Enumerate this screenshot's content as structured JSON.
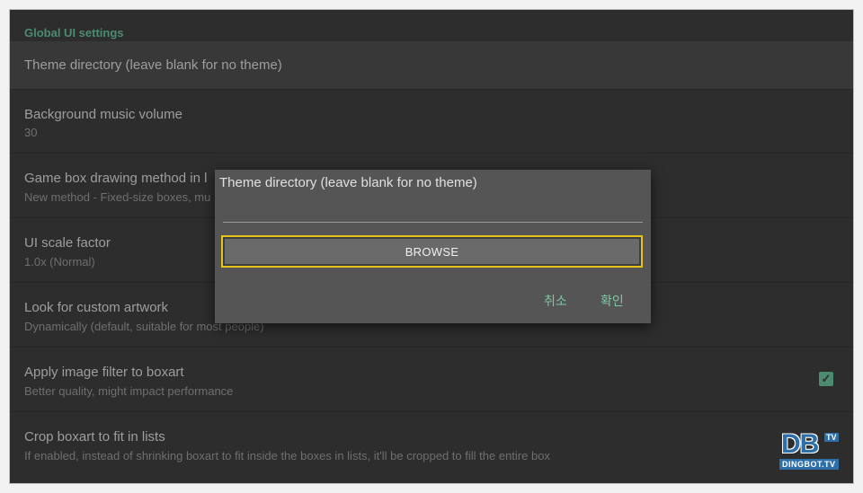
{
  "section": {
    "title": "Global UI settings"
  },
  "prefs": [
    {
      "title": "Theme directory (leave blank for no theme)",
      "summary": ""
    },
    {
      "title": "Background music volume",
      "summary": "30"
    },
    {
      "title": "Game box drawing method in l",
      "summary": "New method - Fixed-size boxes, mu"
    },
    {
      "title": "UI scale factor",
      "summary": "1.0x (Normal)"
    },
    {
      "title": "Look for custom artwork",
      "summary": "Dynamically (default, suitable for most people)"
    },
    {
      "title": "Apply image filter to boxart",
      "summary": "Better quality, might impact performance",
      "checked": true
    },
    {
      "title": "Crop boxart to fit in lists",
      "summary": "If enabled, instead of shrinking boxart to fit inside the boxes in lists, it'll be cropped to fill the entire box"
    }
  ],
  "dialog": {
    "title": "Theme directory (leave blank for no theme)",
    "input_value": "",
    "browse_label": "BROWSE",
    "cancel_label": "취소",
    "ok_label": "확인"
  },
  "watermark": {
    "big": "DB",
    "tv": "TV",
    "small": "DINGBOT.TV"
  },
  "colors": {
    "accent": "#4c8b6f",
    "dialog_button": "#7fc7a4",
    "focus": "#e8c11a"
  }
}
